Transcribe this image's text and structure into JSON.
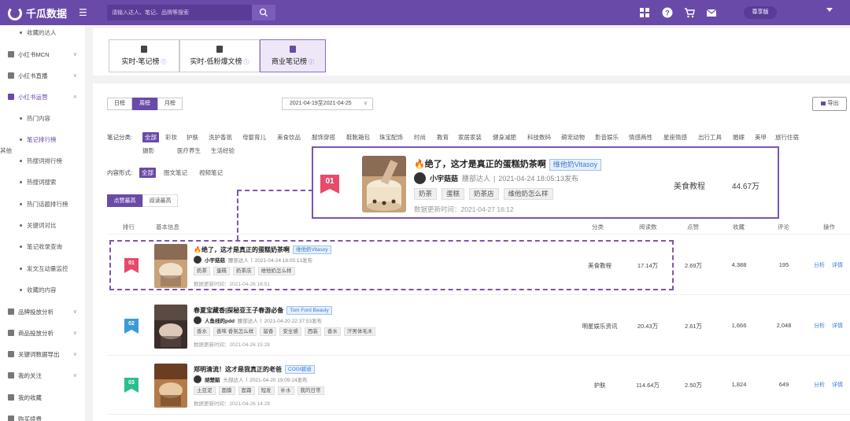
{
  "app": {
    "name": "千瓜数据",
    "version_badge": "尊享版"
  },
  "search": {
    "placeholder": "请输入达人、笔记、品牌等搜索"
  },
  "sidebar": {
    "items": [
      {
        "label": "收藏的达人",
        "type": "sub"
      },
      {
        "label": "小红书MCN",
        "type": "group"
      },
      {
        "label": "小红书直播",
        "type": "group"
      },
      {
        "label": "小红书运营",
        "type": "group",
        "active": true
      },
      {
        "label": "热门内容",
        "type": "sub"
      },
      {
        "label": "笔记排行榜",
        "type": "sub",
        "active": true
      },
      {
        "label": "热搜词排行榜",
        "type": "sub"
      },
      {
        "label": "热搜词搜索",
        "type": "sub"
      },
      {
        "label": "热门话题排行榜",
        "type": "sub"
      },
      {
        "label": "关键词对比",
        "type": "sub"
      },
      {
        "label": "笔记收录查询",
        "type": "sub"
      },
      {
        "label": "发文互动量监控",
        "type": "sub"
      },
      {
        "label": "收藏的内容",
        "type": "sub"
      },
      {
        "label": "品牌投放分析",
        "type": "group"
      },
      {
        "label": "商品投放分析",
        "type": "group"
      },
      {
        "label": "关键词数据导出",
        "type": "group"
      },
      {
        "label": "我的关注",
        "type": "group"
      },
      {
        "label": "我的收藏",
        "type": "group"
      },
      {
        "label": "购买续费",
        "type": "group"
      }
    ]
  },
  "rank_tabs": [
    {
      "label": "实时-笔记榜"
    },
    {
      "label": "实时-低粉爆文榜"
    },
    {
      "label": "商业笔记榜",
      "active": true
    }
  ],
  "period": {
    "day": "日榜",
    "week": "周榜",
    "month": "月榜",
    "date_range": "2021-04-19至2021-04-25"
  },
  "export_label": "导出",
  "categories": {
    "label": "笔记分类:",
    "items": [
      "全部",
      "彩妆",
      "护肤",
      "洗护香氛",
      "母婴育儿",
      "美食饮品",
      "服饰穿搭",
      "鞋靴箱包",
      "珠宝配饰",
      "时尚",
      "教育",
      "家居家装",
      "健身减肥",
      "科技数码",
      "萌宠动物",
      "影音娱乐",
      "情感两性",
      "星座情感",
      "出行工具",
      "婚嫁",
      "美甲",
      "旅行住宿",
      "摄影",
      "医疗养生",
      "生活经验",
      "其他"
    ]
  },
  "content_form": {
    "label": "内容形式:",
    "items": [
      "全部",
      "图文笔记",
      "视频笔记"
    ]
  },
  "sort_tabs": [
    "点赞最高",
    "阅读最高"
  ],
  "table": {
    "headers": {
      "rank": "排行",
      "basic": "基本信息",
      "category": "分类",
      "reads": "阅读数",
      "likes": "点赞",
      "collects": "收藏",
      "comments": "评论",
      "ops": "操作"
    },
    "rows": [
      {
        "rank": "01",
        "rank_color": "#e84a6a",
        "title": "🔥绝了，这才是真正的蛋糕奶茶啊",
        "brand": "维他奶Vitasoy",
        "author": "小宇菇菇",
        "level": "腰部达人",
        "published": "2021-04-24 18:05:13发布",
        "tags": [
          "奶茶",
          "蛋糕",
          "奶茶店",
          "维他奶怎么样"
        ],
        "updated": "数据更新时间：2021-04-26 16:51",
        "category": "美食教程",
        "reads": "17.14万",
        "likes": "2.69万",
        "collects": "4,388",
        "comments": "195"
      },
      {
        "rank": "02",
        "rank_color": "#3a9bd8",
        "title": "春夏宝藏香|探秘亚王子春游必备",
        "brand": "Tom Ford Beauty",
        "author": "人鱼线的pdd",
        "level": "腰部达人",
        "published": "2021-04-20 22:37:53发布",
        "tags": [
          "香水",
          "香味 香氛怎么样",
          "留香",
          "安全感",
          "西装",
          "香水",
          "汗男体毛木"
        ],
        "updated": "数据更新时间：2021-04-26 15:28",
        "category": "明星娱乐资讯",
        "reads": "20.43万",
        "likes": "2.61万",
        "collects": "1,666",
        "comments": "2,048"
      },
      {
        "rank": "03",
        "rank_color": "#2bbf8f",
        "title": "郑明清流！这才是我真正的老爸",
        "brand": "COGI碧迪",
        "author": "胡楚韶",
        "level": "头部达人",
        "published": "2021-04-20 19:09:24发布",
        "tags": [
          "土豆泥",
          "面膜",
          "面霜",
          "短发",
          "补水",
          "我的日常"
        ],
        "updated": "数据更新时间：2021-04-26 14:29",
        "category": "护肤",
        "reads": "114.64万",
        "likes": "2.50万",
        "collects": "1,824",
        "comments": "649"
      }
    ],
    "op_analyze": "分析",
    "op_detail": "详情"
  },
  "zoom": {
    "rank": "01",
    "title": "🔥绝了，这才是真正的蛋糕奶茶啊",
    "brand": "维他奶Vitasoy",
    "author": "小宇菇菇",
    "level": "腰部达人",
    "published": "2021-04-24 18:05:13发布",
    "tags": [
      "奶茶",
      "蛋糕",
      "奶茶店",
      "维他奶怎么样"
    ],
    "updated": "数据更新时间：2021-04-27 16:12",
    "category": "美食教程",
    "reads": "44.67万"
  },
  "colors": {
    "brand": "#6a4aa8",
    "rank1": "#e84a6a",
    "rank2": "#3a9bd8",
    "rank3": "#2bbf8f",
    "link": "#3a7bd5"
  }
}
